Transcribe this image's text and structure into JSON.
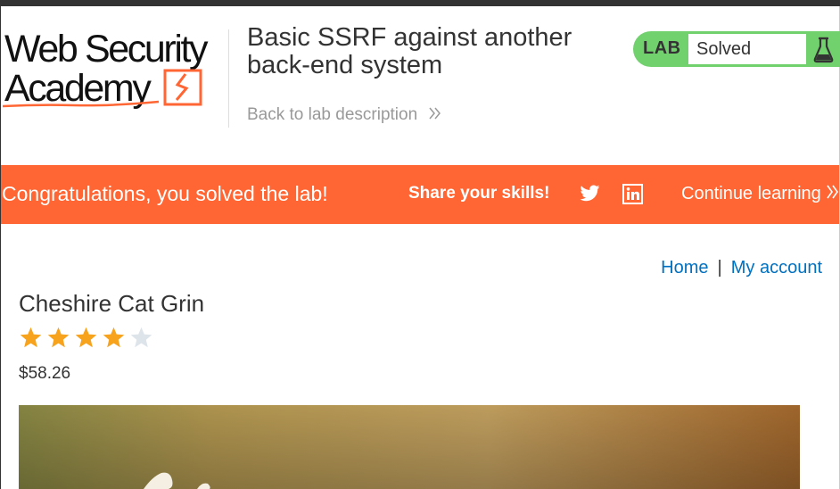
{
  "header": {
    "logo": {
      "line1": "Web Security",
      "line2": "Academy"
    },
    "lab_title_line1": "Basic SSRF against another",
    "lab_title_line2": "back-end system",
    "back_link": "Back to lab description",
    "lab_status": {
      "label": "LAB",
      "status": "Solved",
      "accent": "#70d16d"
    }
  },
  "banner": {
    "message": "Congratulations, you solved the lab!",
    "share_label": "Share your skills!",
    "continue_label": "Continue learning",
    "background": "#ff6633",
    "icons": [
      "twitter-icon",
      "linkedin-icon"
    ]
  },
  "nav": {
    "home": "Home",
    "separator": "|",
    "account": "My account",
    "link_color": "#0070c0"
  },
  "product": {
    "name": "Cheshire Cat Grin",
    "rating": 4,
    "rating_max": 5,
    "price": "$58.26",
    "star_color": "#f8a31d",
    "star_empty_color": "#dde4ea"
  }
}
